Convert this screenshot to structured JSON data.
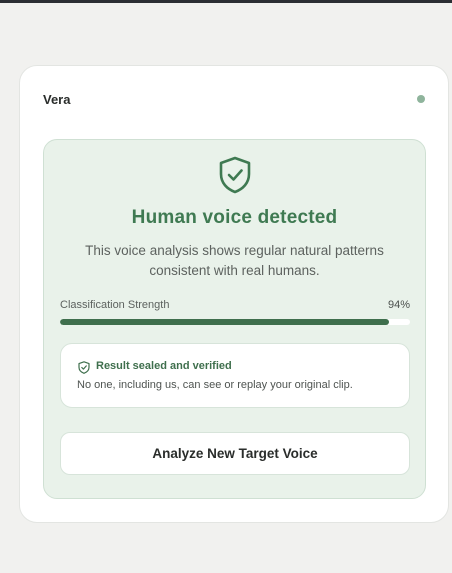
{
  "app": {
    "brand_name": "Vera"
  },
  "result": {
    "headline": "Human voice detected",
    "description": "This voice analysis shows regular natural patterns consistent with real humans.",
    "strength_label": "Classification Strength",
    "strength_value": "94%",
    "strength_fraction": 0.94,
    "sealed_title": "Result sealed and verified",
    "sealed_text": "No one, including us, can see or replay your original clip.",
    "action_label": "Analyze New Target Voice"
  },
  "colors": {
    "accent": "#3f7a52",
    "panel_bg": "#e9f2ea",
    "bar_fill": "#3f6f4d",
    "status_dot": "#8fb49c"
  },
  "icons": {
    "result_icon": "shield-check-icon",
    "sealed_icon": "shield-check-icon"
  }
}
